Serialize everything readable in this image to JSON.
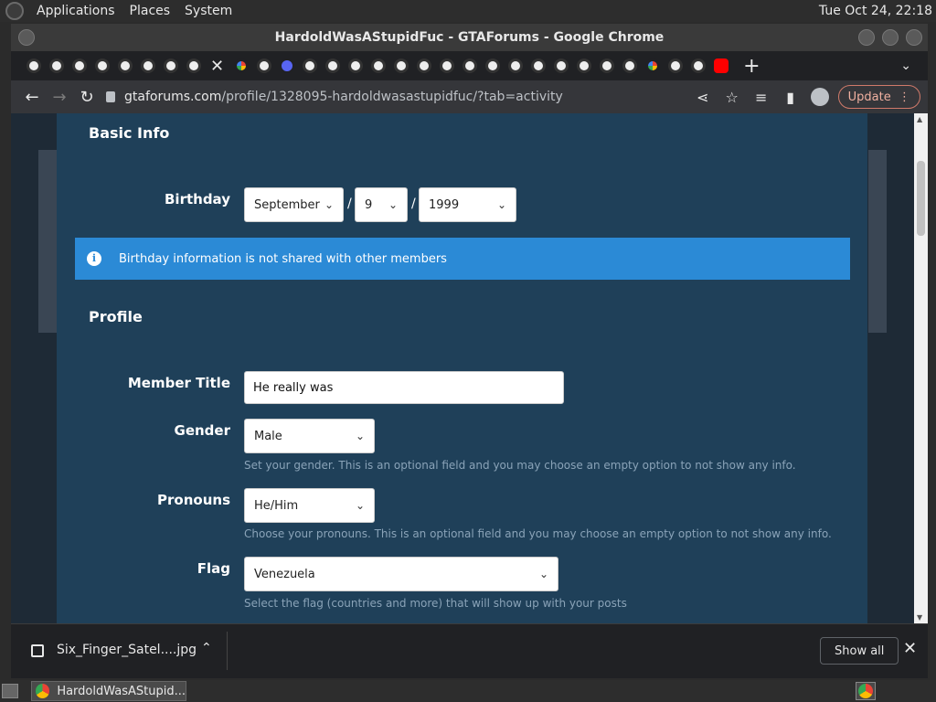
{
  "panel": {
    "applications": "Applications",
    "places": "Places",
    "system": "System",
    "clock": "Tue Oct 24, 22:18"
  },
  "window": {
    "title": "HardoldWasAStupidFuc - GTAForums - Google Chrome"
  },
  "toolbar": {
    "url_host": "gtaforums.com",
    "url_path": "/profile/1328095-hardoldwasastupidfuc/?tab=activity",
    "update_label": "Update"
  },
  "basic_info": {
    "title": "Basic Info",
    "birthday_label": "Birthday",
    "month": "September",
    "day": "9",
    "year": "1999",
    "separator": "/",
    "info_text": "Birthday information is not shared with other members"
  },
  "profile": {
    "title": "Profile",
    "member_title_label": "Member Title",
    "member_title_value": "He really was",
    "gender_label": "Gender",
    "gender_value": "Male",
    "gender_hint": "Set your gender. This is an optional field and you may choose an empty option to not show any info.",
    "pronouns_label": "Pronouns",
    "pronouns_value": "He/Him",
    "pronouns_hint": "Choose your pronouns. This is an optional field and you may choose an empty option to not show any info.",
    "flag_label": "Flag",
    "flag_value": "Venezuela",
    "flag_hint": "Select the flag (countries and more) that will show up with your posts"
  },
  "downloads": {
    "file_name": "Six_Finger_Satel....jpg",
    "show_all": "Show all"
  },
  "taskbar": {
    "window_label": "HardoldWasAStupid..."
  },
  "colors": {
    "modal_bg": "#1f4059",
    "info_banner": "#2b8ad6"
  }
}
